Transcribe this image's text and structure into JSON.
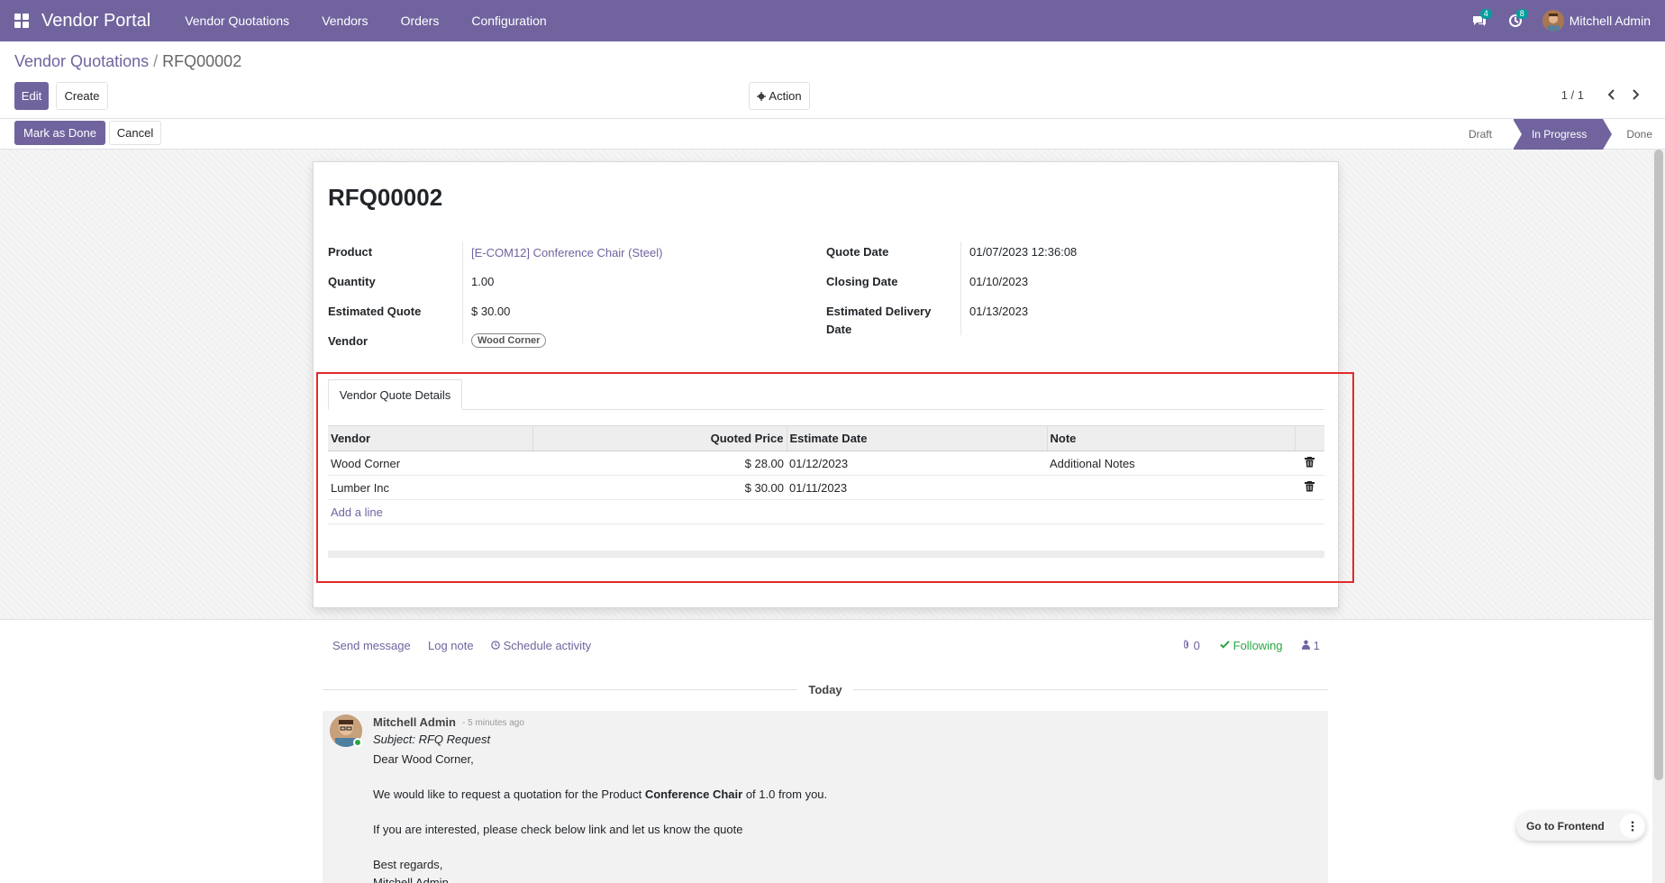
{
  "navbar": {
    "brand": "Vendor Portal",
    "menu": [
      "Vendor Quotations",
      "Vendors",
      "Orders",
      "Configuration"
    ],
    "messages_count": "4",
    "activities_count": "8",
    "user_name": "Mitchell Admin"
  },
  "breadcrumb": {
    "parent": "Vendor Quotations",
    "separator": "/",
    "current": "RFQ00002"
  },
  "buttons": {
    "edit": "Edit",
    "create": "Create",
    "action": "Action",
    "mark_done": "Mark as Done",
    "cancel": "Cancel"
  },
  "pager": {
    "text": "1 / 1"
  },
  "status": {
    "steps": [
      "Draft",
      "In Progress",
      "Done"
    ],
    "active": "In Progress"
  },
  "record": {
    "title": "RFQ00002",
    "left_fields": [
      {
        "label": "Product",
        "value": "[E-COM12] Conference Chair (Steel)"
      },
      {
        "label": "Quantity",
        "value": "1.00"
      },
      {
        "label": "Estimated Quote",
        "value": "$ 30.00"
      },
      {
        "label": "Vendor",
        "value": "Wood Corner"
      }
    ],
    "right_fields": [
      {
        "label": "Quote Date",
        "value": "01/07/2023 12:36:08"
      },
      {
        "label": "Closing Date",
        "value": "01/10/2023"
      },
      {
        "label": "Estimated Delivery",
        "label2": "Date",
        "value": "01/13/2023"
      }
    ]
  },
  "tabs": {
    "vendor_quote_details": "Vendor Quote Details"
  },
  "quote_table": {
    "columns": [
      "Vendor",
      "Quoted Price",
      "Estimate Date",
      "Note"
    ],
    "rows": [
      {
        "vendor": "Wood Corner",
        "price": "$ 28.00",
        "date": "01/12/2023",
        "note": "Additional Notes"
      },
      {
        "vendor": "Lumber Inc",
        "price": "$ 30.00",
        "date": "01/11/2023",
        "note": ""
      }
    ],
    "add_line": "Add a line"
  },
  "chatter": {
    "send_message": "Send message",
    "log_note": "Log note",
    "schedule_activity": "Schedule activity",
    "attachments": "0",
    "following": "Following",
    "followers": "1",
    "today": "Today",
    "message": {
      "author": "Mitchell Admin",
      "time": "- 5 minutes ago",
      "subject": "Subject: RFQ Request",
      "greeting": "Dear Wood Corner,",
      "body_pre": "We would like to request a quotation for the Product ",
      "body_bold": "Conference Chair",
      "body_post": " of 1.0 from you.",
      "interest": "If you are interested, please check below link and let us know the quote",
      "regards": "Best regards,",
      "signature": "Mitchell Admin"
    }
  },
  "floating": {
    "go_frontend": "Go to Frontend"
  },
  "colors": {
    "brand": "#71639e",
    "highlight": "#e32a2a",
    "following": "#28a745"
  }
}
